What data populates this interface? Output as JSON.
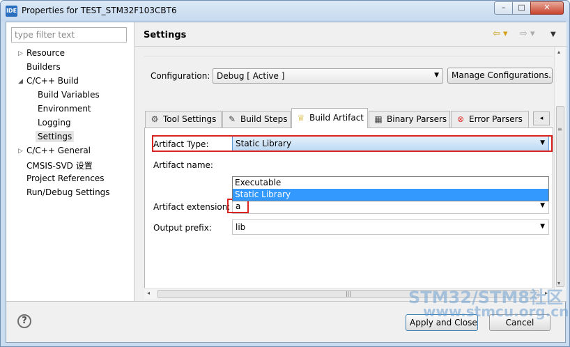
{
  "window": {
    "icon_text": "IDE",
    "title": "Properties for TEST_STM32F103CBT6",
    "min_glyph": "–",
    "max_glyph": "□",
    "close_glyph": "✕"
  },
  "sidebar": {
    "filter_placeholder": "type filter text",
    "items": [
      {
        "label": "Resource",
        "arrow": "▷"
      },
      {
        "label": "Builders"
      },
      {
        "label": "C/C++ Build",
        "arrow": "◢"
      },
      {
        "label": "Build Variables"
      },
      {
        "label": "Environment"
      },
      {
        "label": "Logging"
      },
      {
        "label": "Settings",
        "selected": true
      },
      {
        "label": "C/C++ General",
        "arrow": "▷"
      },
      {
        "label": "CMSIS-SVD 设置"
      },
      {
        "label": "Project References"
      },
      {
        "label": "Run/Debug Settings"
      }
    ]
  },
  "header": {
    "title": "Settings",
    "back_glyph": "⇦ ▾",
    "forward_glyph": "⇨ ▾",
    "menu_glyph": "▼"
  },
  "configuration": {
    "label": "Configuration:",
    "value": "Debug  [ Active ]",
    "manage_button": "Manage Configurations..."
  },
  "tabs": [
    {
      "label": "Tool Settings",
      "icon": "⚙"
    },
    {
      "label": "Build Steps",
      "icon": "✎"
    },
    {
      "label": "Build Artifact",
      "icon": "♕",
      "active": true
    },
    {
      "label": "Binary Parsers",
      "icon": "▦"
    },
    {
      "label": "Error Parsers",
      "icon": "⊗"
    }
  ],
  "tab_scroll_glyph": "◂",
  "fields": {
    "artifact_type": {
      "label": "Artifact Type:",
      "value": "Static Library"
    },
    "artifact_name": {
      "label": "Artifact name:"
    },
    "artifact_extension": {
      "label": "Artifact extension:",
      "value": "a"
    },
    "output_prefix": {
      "label": "Output prefix:",
      "value": "lib"
    }
  },
  "dropdown_options": [
    {
      "label": "Executable"
    },
    {
      "label": "Static Library",
      "selected": true
    }
  ],
  "combo_arrow": "▼",
  "hscroll": {
    "left": "◂",
    "right": "▸",
    "grip": "|||"
  },
  "vscroll": {
    "up": "▴",
    "down": "▾",
    "grip": "≡"
  },
  "footer": {
    "help_glyph": "?",
    "apply_button": "Apply and Close",
    "cancel_button": "Cancel"
  },
  "watermark": {
    "line1": "STM32/STM8社区",
    "line2": "www.stmcu.org.cn"
  }
}
